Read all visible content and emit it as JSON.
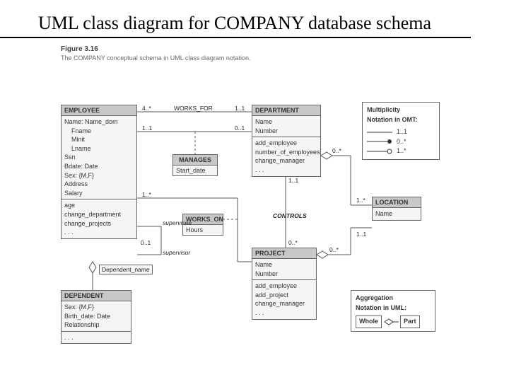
{
  "title": "UML class diagram for COMPANY database schema",
  "figure": {
    "num": "Figure 3.16",
    "caption": "The COMPANY conceptual schema in UML class diagram notation."
  },
  "classes": {
    "employee": {
      "name": "EMPLOYEE",
      "attrs": [
        "Name: Name_dom",
        "  Fname",
        "  Minit",
        "  Lname",
        "Ssn",
        "Bdate: Date",
        "Sex: {M,F}",
        "Address",
        "Salary"
      ],
      "ops": [
        "age",
        "change_department",
        "change_projects",
        ". . ."
      ]
    },
    "department": {
      "name": "DEPARTMENT",
      "attrs": [
        "Name",
        "Number"
      ],
      "ops": [
        "add_employee",
        "number_of_employees",
        "change_manager",
        ". . ."
      ]
    },
    "location": {
      "name": "LOCATION",
      "attrs": [
        "Name"
      ]
    },
    "project": {
      "name": "PROJECT",
      "attrs": [
        "Name",
        "Number"
      ],
      "ops": [
        "add_employee",
        "add_project",
        "change_manager",
        ". . ."
      ]
    },
    "dependent": {
      "name": "DEPENDENT",
      "attrs": [
        "Sex: {M,F}",
        "Birth_date: Date",
        "Relationship"
      ],
      "ops": [
        ". . ."
      ]
    }
  },
  "assoc": {
    "manages": {
      "name": "MANAGES",
      "attr": "Start_date"
    },
    "works_on": {
      "name": "WORKS_ON",
      "attr": "Hours"
    }
  },
  "labels": {
    "works_for": "WORKS_FOR",
    "controls": "CONTROLS",
    "dep_name": "Dependent_name",
    "supervisee": "supervisee",
    "supervisor": "supervisor",
    "m4s": "4..*",
    "m11a": "1..1",
    "m11b": "1..1",
    "m01": "0..1",
    "m1s": "1..*",
    "m0s_a": "0..*",
    "m0s_b": "0..*",
    "m11c": "1..1",
    "m1s_b": "1..*",
    "m11d": "1..1",
    "m01b": "0..1",
    "m0s_c": "0..*"
  },
  "legendOMT": {
    "title1": "Multiplicity",
    "title2": "Notation in OMT:",
    "r1": "1..1",
    "r2": "0..*",
    "r3": "1..*"
  },
  "legendAgg": {
    "title1": "Aggregation",
    "title2": "Notation in UML:",
    "whole": "Whole",
    "part": "Part"
  }
}
